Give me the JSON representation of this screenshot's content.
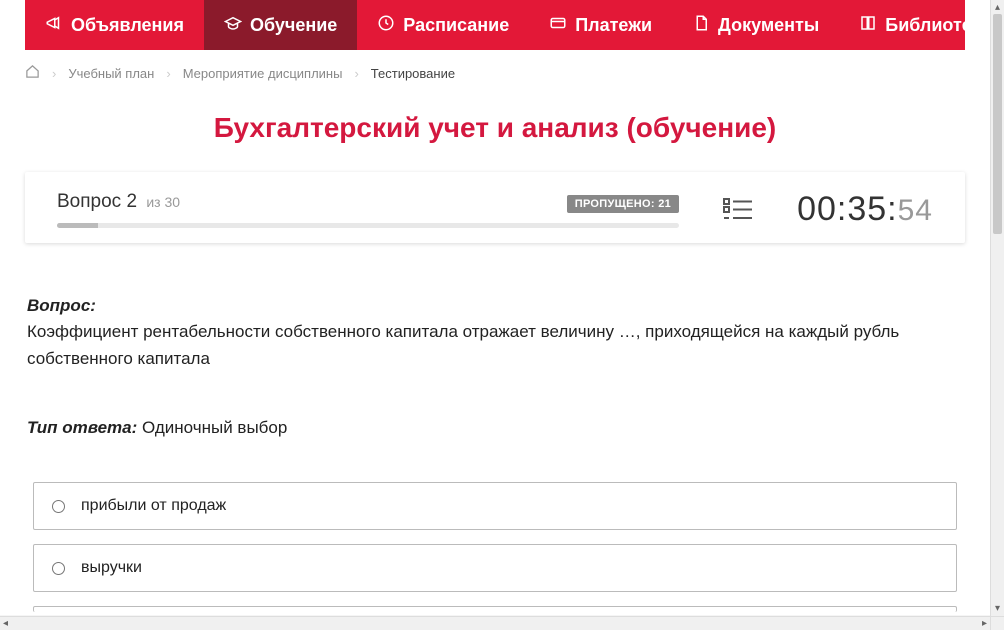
{
  "nav": {
    "items": [
      {
        "label": "Объявления",
        "icon": "megaphone"
      },
      {
        "label": "Обучение",
        "icon": "gradcap",
        "active": true
      },
      {
        "label": "Расписание",
        "icon": "clock"
      },
      {
        "label": "Платежи",
        "icon": "card"
      },
      {
        "label": "Документы",
        "icon": "doc"
      },
      {
        "label": "Библиотека",
        "icon": "book",
        "dropdown": true
      }
    ]
  },
  "breadcrumb": {
    "items": [
      "Учебный план",
      "Мероприятие дисциплины"
    ],
    "current": "Тестирование"
  },
  "title": "Бухгалтерский учет и анализ (обучение)",
  "progress": {
    "question_word": "Вопрос",
    "current": "2",
    "of_word": "из",
    "total": "30",
    "skipped_label": "ПРОПУЩЕНО:",
    "skipped_count": "21"
  },
  "timer": {
    "mm": "00",
    "ss": "35",
    "ms": "54"
  },
  "question": {
    "label": "Вопрос:",
    "text": "Коэффициент рентабельности собственного капитала отражает величину …, приходящейся на каждый рубль собственного капитала",
    "answer_type_label": "Тип ответа:",
    "answer_type_value": "Одиночный выбор",
    "options": [
      "прибыли от продаж",
      "выручки"
    ]
  }
}
